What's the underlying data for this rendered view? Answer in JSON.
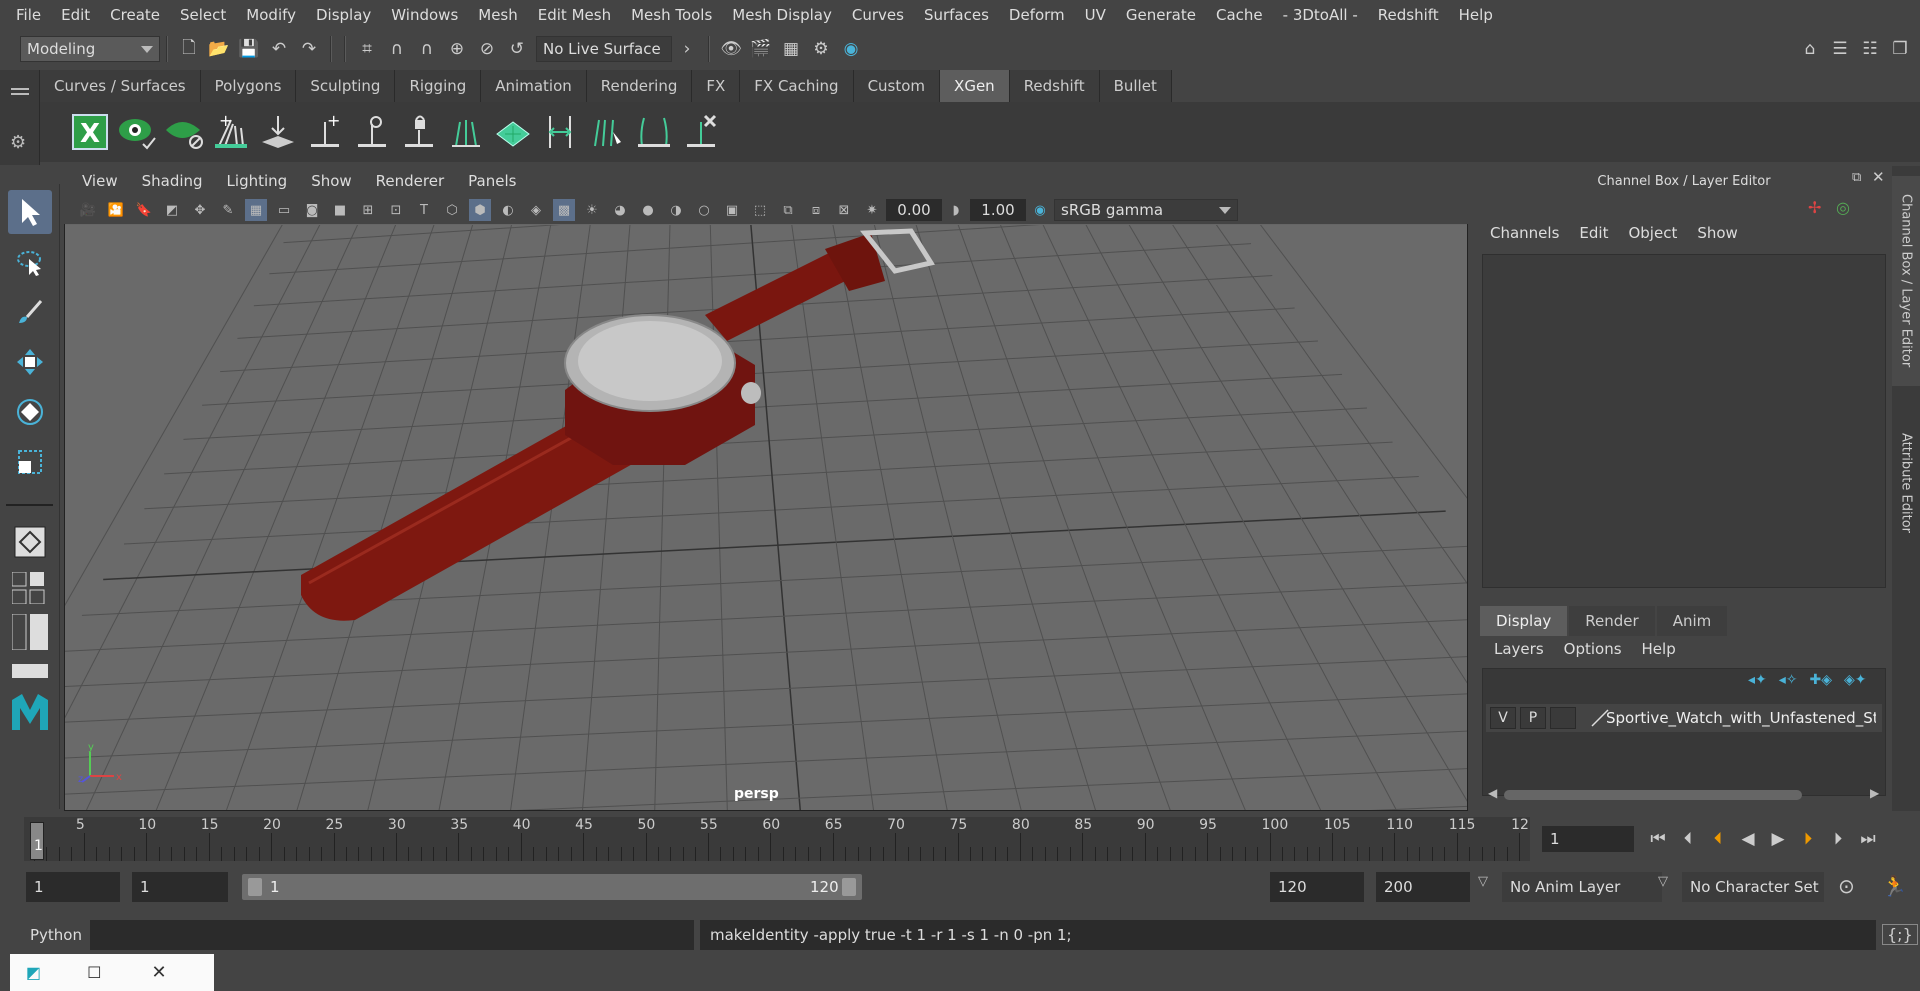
{
  "menubar": [
    "File",
    "Edit",
    "Create",
    "Select",
    "Modify",
    "Display",
    "Windows",
    "Mesh",
    "Edit Mesh",
    "Mesh Tools",
    "Mesh Display",
    "Curves",
    "Surfaces",
    "Deform",
    "UV",
    "Generate",
    "Cache",
    "- 3DtoAll -",
    "Redshift",
    "Help"
  ],
  "statusline": {
    "mode": "Modeling",
    "live_surface": "No Live Surface"
  },
  "shelf_tabs": [
    "Curves / Surfaces",
    "Polygons",
    "Sculpting",
    "Rigging",
    "Animation",
    "Rendering",
    "FX",
    "FX Caching",
    "Custom",
    "XGen",
    "Redshift",
    "Bullet"
  ],
  "shelf_active": "XGen",
  "viewport": {
    "menu": [
      "View",
      "Shading",
      "Lighting",
      "Show",
      "Renderer",
      "Panels"
    ],
    "exposure": "0.00",
    "gamma": "1.00",
    "color_space": "sRGB gamma",
    "camera_label": "persp",
    "axis_x": "x",
    "axis_y": "y",
    "axis_z": "z"
  },
  "channel_box": {
    "title": "Channel Box / Layer Editor",
    "menu": [
      "Channels",
      "Edit",
      "Object",
      "Show"
    ]
  },
  "layer_editor": {
    "tabs": [
      "Display",
      "Render",
      "Anim"
    ],
    "active_tab": "Display",
    "menu": [
      "Layers",
      "Options",
      "Help"
    ],
    "layer": {
      "v": "V",
      "p": "P",
      "name": "Sportive_Watch_with_Unfastened_Str"
    }
  },
  "side_tabs": [
    "Channel Box / Layer Editor",
    "Attribute Editor"
  ],
  "timeline": {
    "ticks": [
      "5",
      "10",
      "15",
      "20",
      "25",
      "30",
      "35",
      "40",
      "45",
      "50",
      "55",
      "60",
      "65",
      "70",
      "75",
      "80",
      "85",
      "90",
      "95",
      "100",
      "105",
      "110",
      "115",
      "12"
    ],
    "current_frame_marker": "1",
    "current_frame": "1"
  },
  "range": {
    "start": "1",
    "playback_start": "1",
    "slider_start": "1",
    "slider_end": "120",
    "playback_end": "120",
    "end": "200",
    "anim_layer": "No Anim Layer",
    "character_set": "No Character Set"
  },
  "command": {
    "lang": "Python",
    "output": "makeIdentity -apply true -t 1 -r 1 -s 1 -n 0 -pn 1;"
  },
  "colors": {
    "accent": "#5c6f8a",
    "strap": "#8a1a12",
    "xgen_green": "#2e9e48"
  }
}
